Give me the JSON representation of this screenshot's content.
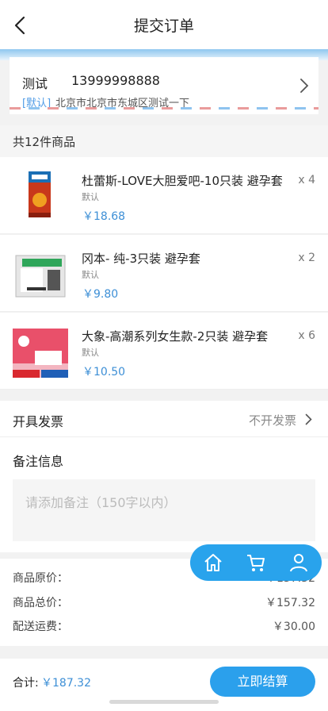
{
  "header": {
    "title": "提交订单"
  },
  "address": {
    "name": "测试",
    "phone": "13999998888",
    "tag": "[默认]",
    "detail": "北京市北京市东城区测试一下"
  },
  "products_count": "共12件商品",
  "products": [
    {
      "name": "杜蕾斯-LOVE大胆爱吧-10只装 避孕套",
      "spec": "默认",
      "price": "￥18.68",
      "qty": "x 4",
      "thumb_color": "#c8381b"
    },
    {
      "name": "冈本- 纯-3只装 避孕套",
      "spec": "默认",
      "price": "￥9.80",
      "qty": "x 2",
      "thumb_color": "#d7d7d7"
    },
    {
      "name": "大象-高潮系列女生款-2只装 避孕套",
      "spec": "默认",
      "price": "￥10.50",
      "qty": "x 6",
      "thumb_color": "#e9506a"
    }
  ],
  "invoice": {
    "label": "开具发票",
    "value": "不开发票"
  },
  "remark": {
    "label": "备注信息",
    "placeholder": "请添加备注（150字以内）"
  },
  "summary": {
    "rows": [
      {
        "label": "商品原价：",
        "value": "￥157.32"
      },
      {
        "label": "商品总价：",
        "value": "￥157.32"
      },
      {
        "label": "配送运费：",
        "value": "￥30.00"
      }
    ]
  },
  "float_nav": {
    "icons": [
      "home-icon",
      "cart-icon",
      "user-icon"
    ],
    "color": "#29a3ec"
  },
  "footer": {
    "total_label": "合计:",
    "total_value": "￥187.32",
    "checkout_label": "立即结算"
  },
  "colors": {
    "accent": "#2ba0ec",
    "price": "#3d8fd6"
  }
}
